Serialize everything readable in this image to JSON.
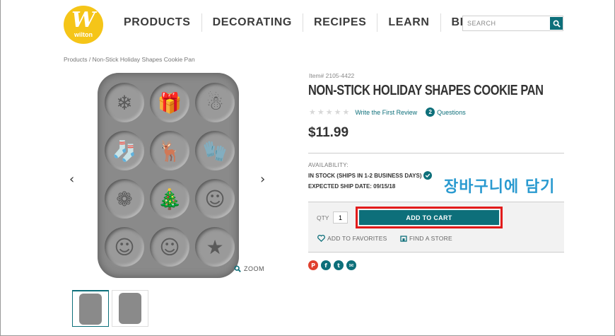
{
  "header": {
    "logo_text": "wilton",
    "logo_letter": "W",
    "nav": [
      "PRODUCTS",
      "DECORATING",
      "RECIPES",
      "LEARN",
      "BLOG"
    ],
    "search_placeholder": "SEARCH"
  },
  "breadcrumb": "Products / Non-Stick Holiday Shapes Cookie Pan",
  "gallery": {
    "prev": "‹",
    "next": "›",
    "zoom_label": "ZOOM",
    "shapes": [
      "❄",
      "🎁",
      "☃",
      "🧦",
      "🦌",
      "🧤",
      "❁",
      "🎄",
      "☺",
      "☺",
      "☺",
      "★"
    ]
  },
  "product": {
    "item_number": "Item# 2105-4422",
    "title": "NON-STICK HOLIDAY SHAPES COOKIE PAN",
    "stars": "★★★★★",
    "review_link": "Write the First Review",
    "question_count": "2",
    "questions_label": "Questions",
    "price": "$11.99",
    "availability_label": "AVAILABILITY:",
    "availability_status": "IN STOCK (SHIPS IN 1-2 BUSINESS DAYS)",
    "ship_date": "EXPECTED SHIP DATE: 09/15/18",
    "qty_label": "QTY",
    "qty_value": "1",
    "add_to_cart": "ADD TO CART",
    "add_to_favorites": "ADD TO FAVORITES",
    "find_store": "FIND A STORE"
  },
  "annotation": {
    "korean_text": "장바구니에 담기",
    "highlight_color": "#e21b1b"
  },
  "social": [
    {
      "name": "pinterest-icon",
      "glyph": "P",
      "color": "#e0402e"
    },
    {
      "name": "facebook-icon",
      "glyph": "f",
      "color": "#0d6f7a"
    },
    {
      "name": "twitter-icon",
      "glyph": "t",
      "color": "#0d6f7a"
    },
    {
      "name": "email-icon",
      "glyph": "✉",
      "color": "#0d6f7a"
    }
  ],
  "colors": {
    "brand_teal": "#0d6f7a",
    "logo_yellow": "#f5c518",
    "annotation_blue": "#2a9ad0"
  }
}
